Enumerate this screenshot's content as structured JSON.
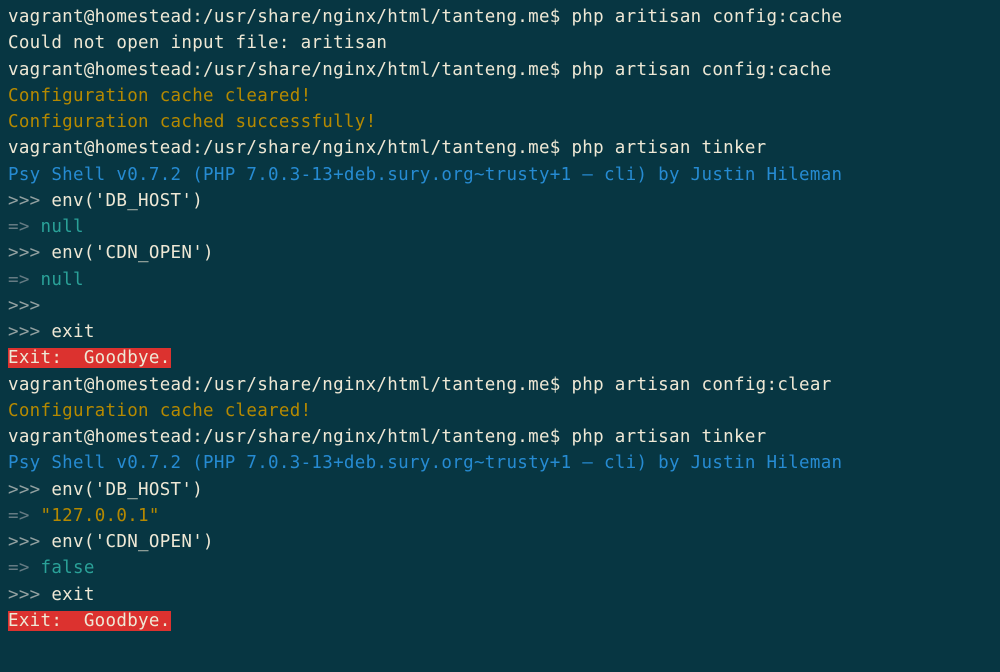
{
  "prompt": "vagrant@homestead:/usr/share/nginx/html/tanteng.me$ ",
  "cmd1": "php aritisan config:cache",
  "err1": "Could not open input file: aritisan",
  "cmd2": "php artisan config:cache",
  "cache_cleared": "Configuration cache cleared!",
  "cache_success": "Configuration cached successfully!",
  "cmd3": "php artisan tinker",
  "psy_shell": "Psy Shell v0.7.2 (PHP 7.0.3-13+deb.sury.org~trusty+1 — cli) by Justin Hileman",
  "repl_prompt": ">>> ",
  "result_arrow": "=> ",
  "env_dbhost": "env('DB_HOST')",
  "null_val": "null",
  "env_cdnopen": "env('CDN_OPEN')",
  "empty_repl": ">>>",
  "exit_cmd": "exit",
  "exit_msg": "Exit:  Goodbye.",
  "cmd4": "php artisan config:clear",
  "cmd5": "php artisan tinker",
  "ip_val": "\"127.0.0.1\"",
  "false_val": "false"
}
